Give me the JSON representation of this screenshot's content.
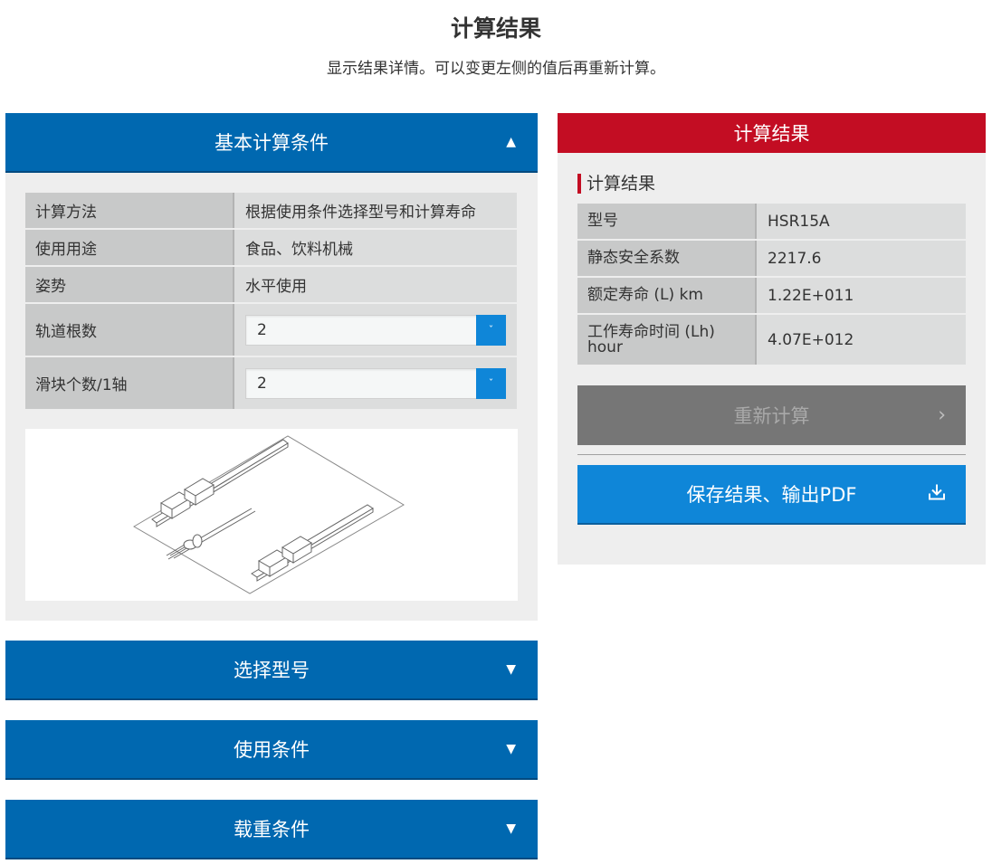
{
  "page": {
    "title": "计算结果",
    "subtitle": "显示结果详情。可以变更左侧的值后再重新计算。"
  },
  "accordions": {
    "basic": {
      "label": "基本计算条件",
      "expanded": true
    },
    "model": {
      "label": "选择型号",
      "expanded": false
    },
    "usage": {
      "label": "使用条件",
      "expanded": false
    },
    "load": {
      "label": "载重条件",
      "expanded": false
    }
  },
  "conditions": {
    "method": {
      "label": "计算方法",
      "value": "根据使用条件选择型号和计算寿命"
    },
    "application": {
      "label": "使用用途",
      "value": "食品、饮料机械"
    },
    "orientation": {
      "label": "姿势",
      "value": "水平使用"
    },
    "rails": {
      "label": "轨道根数",
      "value": "2"
    },
    "blocks": {
      "label": "滑块个数/1轴",
      "value": "2"
    }
  },
  "result": {
    "header": "计算结果",
    "section_title": "计算结果",
    "rows": [
      {
        "label": "型号",
        "value": "HSR15A"
      },
      {
        "label": "静态安全系数",
        "value": "2217.6"
      },
      {
        "label": "额定寿命 (L) km",
        "value": "1.22E+011"
      },
      {
        "label_line1": "工作寿命时间 (Lh)",
        "label_line2": "hour",
        "value": "4.07E+012"
      }
    ],
    "recalc_label": "重新计算",
    "save_label": "保存结果、输出PDF"
  },
  "colors": {
    "accordion_blue": "#0068b0",
    "button_blue": "#0f86d8",
    "result_red": "#c30d23",
    "disabled_gray": "#767676"
  },
  "icons": {
    "caret_up": "caret-up-icon",
    "caret_down": "caret-down-icon",
    "dropdown": "chevron-down-icon",
    "chevron_right": "chevron-right-icon",
    "download": "download-icon"
  }
}
